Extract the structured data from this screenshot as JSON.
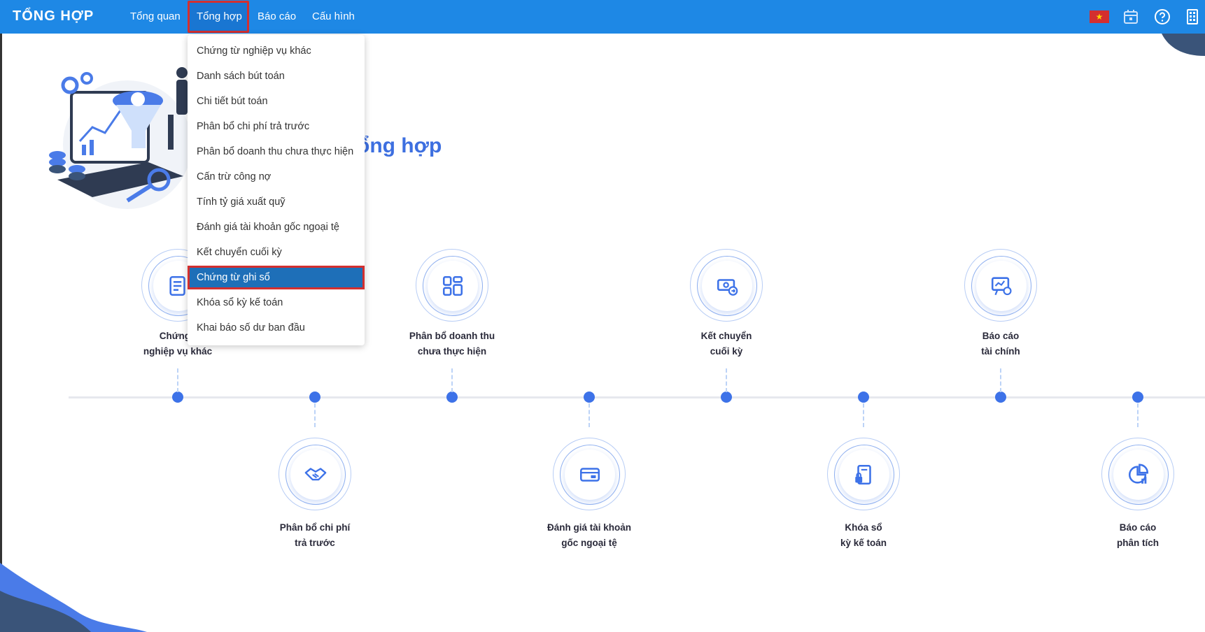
{
  "app": {
    "title": "TỔNG HỢP"
  },
  "nav": {
    "items": [
      {
        "label": "Tổng quan"
      },
      {
        "label": "Tổng hợp"
      },
      {
        "label": "Báo cáo"
      },
      {
        "label": "Cấu hình"
      }
    ]
  },
  "top_icons": {
    "flag": "vietnam-flag",
    "calendar": "calendar-icon",
    "help": "help-icon",
    "apps": "apps-icon"
  },
  "hero": {
    "title_fragment": "ổng hợp"
  },
  "dropdown": {
    "items": [
      {
        "label": "Chứng từ nghiệp vụ khác"
      },
      {
        "label": "Danh sách bút toán"
      },
      {
        "label": "Chi tiết bút toán"
      },
      {
        "label": "Phân bổ chi phí trả trước"
      },
      {
        "label": "Phân bổ doanh thu chưa thực hiện"
      },
      {
        "label": "Cấn trừ công nợ"
      },
      {
        "label": "Tính tỷ giá xuất quỹ"
      },
      {
        "label": "Đánh giá tài khoản gốc ngoại tệ"
      },
      {
        "label": "Kết chuyển cuối kỳ"
      },
      {
        "label": "Chứng từ ghi sổ"
      },
      {
        "label": "Khóa sổ kỳ kế toán"
      },
      {
        "label": "Khai báo số dư ban đầu"
      }
    ],
    "selected": "Chứng từ ghi sổ"
  },
  "timeline": {
    "top": [
      {
        "line1": "Chứng t",
        "line2": "nghiệp vụ khác",
        "icon": "document-icon"
      },
      {
        "line1": "Phân bổ doanh thu",
        "line2": "chưa thực hiện",
        "icon": "grid-icon"
      },
      {
        "line1": "Kết chuyển",
        "line2": "cuối kỳ",
        "icon": "money-transfer-icon"
      },
      {
        "line1": "Báo cáo",
        "line2": "tài chính",
        "icon": "presentation-icon"
      }
    ],
    "bottom": [
      {
        "line1": "Phân bổ chi phí",
        "line2": "trả trước",
        "icon": "handshake-icon"
      },
      {
        "line1": "Đánh giá tài khoản",
        "line2": "gốc ngoại tệ",
        "icon": "card-icon"
      },
      {
        "line1": "Khóa sổ",
        "line2": "kỳ kế toán",
        "icon": "lock-book-icon"
      },
      {
        "line1": "Báo cáo",
        "line2": "phân tích",
        "icon": "pie-chart-icon"
      }
    ]
  },
  "colors": {
    "topbar": "#1e88e5",
    "accent": "#3d72e8",
    "highlight": "#d32f2f",
    "selected_bg": "#1e6fb8"
  }
}
